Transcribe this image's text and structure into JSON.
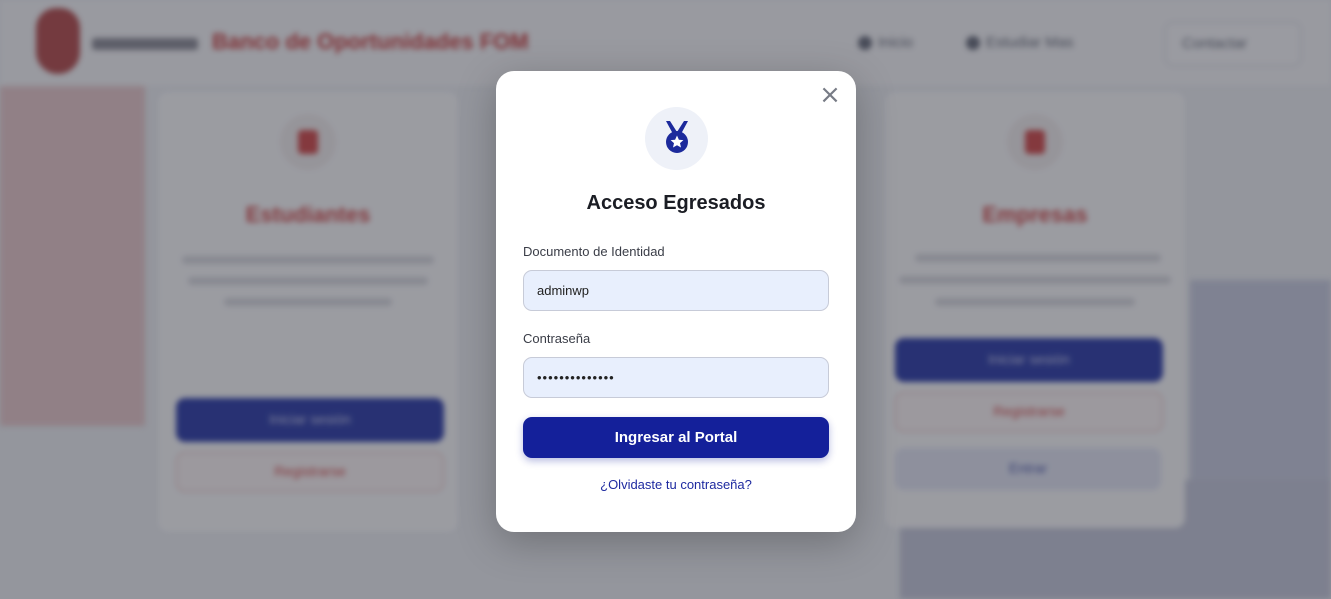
{
  "background": {
    "site_title": "Banco de Oportunidades FOM",
    "nav": {
      "item1": "Inicio",
      "item2": "Estudiar Mas",
      "button": "Contactar"
    },
    "cards": {
      "left": {
        "title": "Estudiantes",
        "primary_button": "Iniciar sesión",
        "secondary_button": "Registrarse"
      },
      "right": {
        "title": "Empresas",
        "primary_button": "Iniciar sesión",
        "secondary_button": "Registrarse",
        "tertiary_button": "Entrar"
      }
    }
  },
  "modal": {
    "icon": "medal-icon",
    "title": "Acceso Egresados",
    "document": {
      "label": "Documento de Identidad",
      "value": "adminwp"
    },
    "password": {
      "label": "Contraseña",
      "value": "••••••••••••••"
    },
    "submit_label": "Ingresar al Portal",
    "forgot_link": "¿Olvidaste tu contraseña?",
    "close_label": "×"
  },
  "colors": {
    "primary": "#14209a",
    "accent_red": "#d24848",
    "input_bg": "#e8effd"
  }
}
